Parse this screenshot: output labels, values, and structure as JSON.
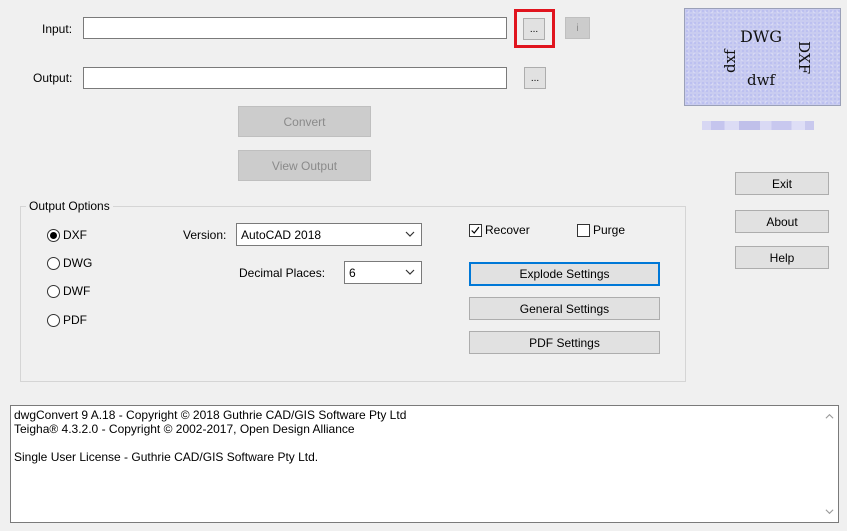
{
  "files": {
    "input_label": "Input:",
    "input_value": "",
    "output_label": "Output:",
    "output_value": "",
    "browse_label": "...",
    "info_label": "i"
  },
  "actions": {
    "convert_label": "Convert",
    "view_output_label": "View Output",
    "exit_label": "Exit",
    "about_label": "About",
    "help_label": "Help"
  },
  "logo": {
    "word_dwg": "DWG",
    "word_dxf": "DXF",
    "word_dwf": "dwf",
    "word_dxf_lower": "dxf"
  },
  "options": {
    "title": "Output Options",
    "formats": [
      {
        "label": "DXF",
        "selected": true
      },
      {
        "label": "DWG",
        "selected": false
      },
      {
        "label": "DWF",
        "selected": false
      },
      {
        "label": "PDF",
        "selected": false
      }
    ],
    "version_label": "Version:",
    "version_value": "AutoCAD 2018",
    "decimal_label": "Decimal Places:",
    "decimal_value": "6",
    "recover_label": "Recover",
    "purge_label": "Purge",
    "explode_settings_label": "Explode Settings",
    "general_settings_label": "General Settings",
    "pdf_settings_label": "PDF Settings"
  },
  "log": {
    "lines": [
      "dwgConvert 9 A.18 - Copyright © 2018 Guthrie CAD/GIS Software Pty Ltd",
      "Teigha® 4.3.2.0 - Copyright © 2002-2017, Open Design Alliance",
      "",
      "Single User License - Guthrie CAD/GIS Software Pty Ltd."
    ]
  },
  "colors": {
    "highlight": "#e0141e",
    "focus": "#0078d7"
  }
}
